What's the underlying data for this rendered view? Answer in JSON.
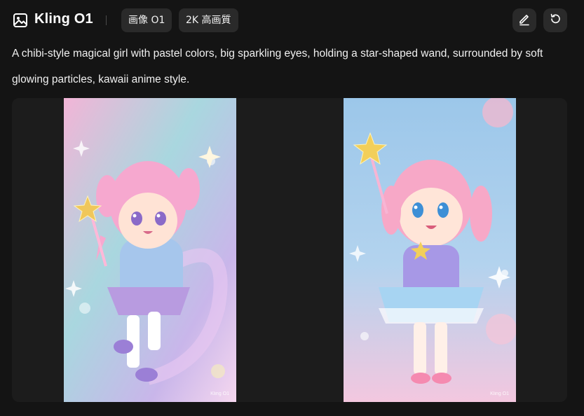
{
  "header": {
    "title": "Kling O1",
    "tags": [
      "画像 O1",
      "2K 高画質"
    ]
  },
  "prompt": "A chibi-style magical girl with pastel colors, big sparkling eyes, holding a star-shaped wand, surrounded by soft glowing particles, kawaii anime style.",
  "images": [
    {
      "watermark": "Kling O1"
    },
    {
      "watermark": "Kling O1"
    }
  ],
  "colors": {
    "background": "#141414",
    "panel": "#1c1c1c",
    "button": "#2a2a2a"
  },
  "icons": [
    "image-icon",
    "edit-icon",
    "retry-icon"
  ]
}
